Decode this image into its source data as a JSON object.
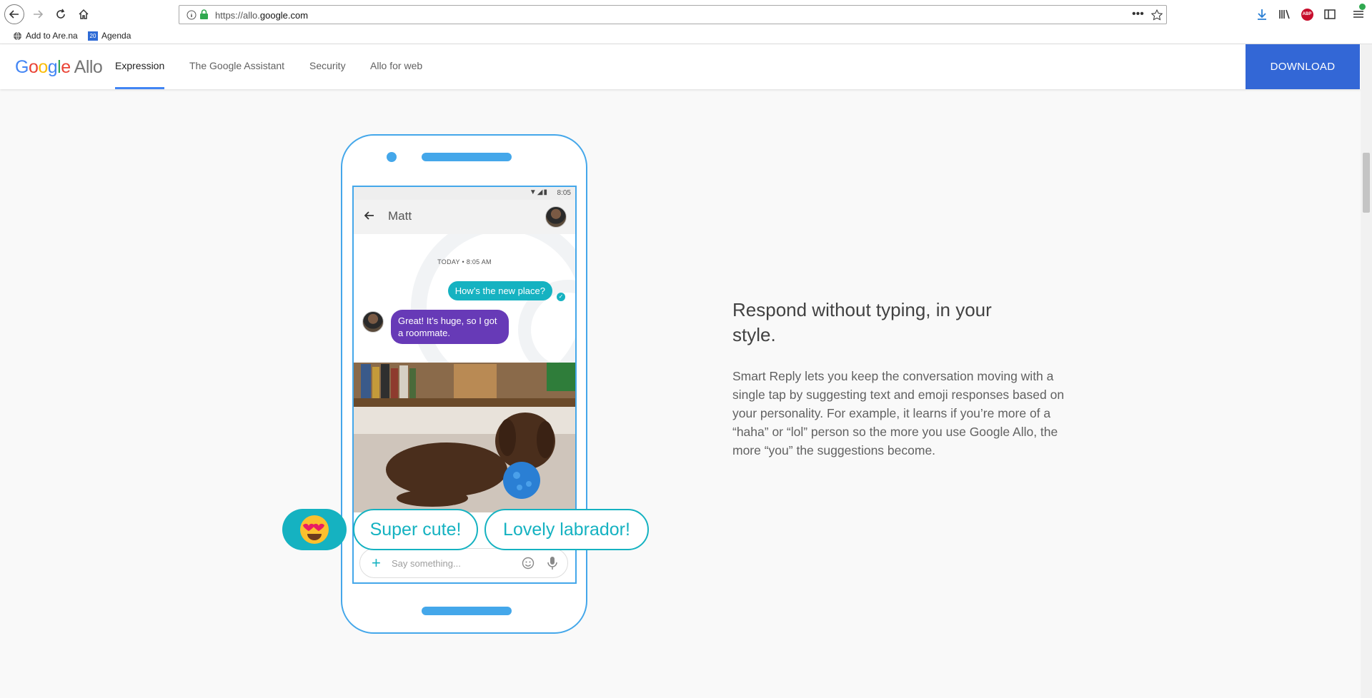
{
  "browser": {
    "url_prefix": "https://allo.",
    "url_domain": "google.com",
    "bookmarks": [
      {
        "label": "Add to Are.na"
      },
      {
        "label": "Agenda",
        "badge": "20"
      }
    ],
    "adblock_label": "ABP"
  },
  "site": {
    "logo_google": "Google",
    "logo_allo": "Allo",
    "nav": [
      {
        "label": "Expression",
        "active": true
      },
      {
        "label": "The Google Assistant",
        "active": false
      },
      {
        "label": "Security",
        "active": false
      },
      {
        "label": "Allo for web",
        "active": false
      }
    ],
    "download_label": "DOWNLOAD"
  },
  "phone": {
    "status_time": "8:05",
    "contact_name": "Matt",
    "timestamp": "TODAY • 8:05 AM",
    "outgoing_message": "How’s the new place?",
    "incoming_message": "Great! It’s huge, so I got a roommate.",
    "input_placeholder": "Say something...",
    "smart_replies": [
      "Super cute!",
      "Lovely labrador!"
    ],
    "smart_reply_emoji": "heart-eyes-emoji"
  },
  "content": {
    "headline": "Respond without typing, in your style.",
    "body": "Smart Reply lets you keep the conversation moving with a single tap by suggesting text and emoji responses based on your personality. For example, it learns if you’re more of a “haha” or “lol” person so the more you use Google Allo, the more “you” the suggestions become."
  },
  "colors": {
    "accent_blue": "#3367d6",
    "phone_outline": "#44a7ea",
    "teal": "#15b2c1",
    "purple": "#673ab7"
  }
}
